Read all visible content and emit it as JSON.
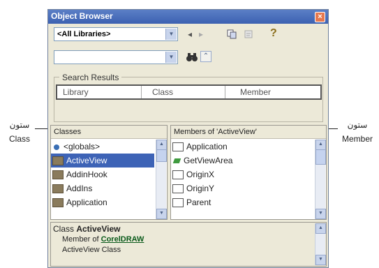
{
  "window": {
    "title": "Object Browser",
    "close_glyph": "×"
  },
  "toolbar": {
    "library_combo": "<All Libraries>",
    "search_combo": "",
    "back_icon": "◂",
    "forward_icon": "▸",
    "copy_icon": "copy-icon",
    "view_def_icon": "view-definition-icon",
    "help_icon": "?",
    "search_icon": "binoculars-icon",
    "toggle_icon": "⌃"
  },
  "search_results": {
    "label": "Search Results",
    "columns": [
      "Library",
      "Class",
      "Member"
    ]
  },
  "classes": {
    "header": "Classes",
    "items": [
      "<globals>",
      "ActiveView",
      "AddinHook",
      "AddIns",
      "Application"
    ],
    "selected": "ActiveView"
  },
  "members": {
    "header": "Members of 'ActiveView'",
    "items": [
      "Application",
      "GetViewArea",
      "OriginX",
      "OriginY",
      "Parent"
    ]
  },
  "details": {
    "line1_prefix": "Class ",
    "line1_name": "ActiveView",
    "line2_prefix": "Member of ",
    "line2_link": "CorelDRAW",
    "line3": "ActiveView Class"
  },
  "annotations": {
    "left_line1": "ستون",
    "left_line2": "Class",
    "right_line1": "ستون",
    "right_line2": "Member"
  }
}
